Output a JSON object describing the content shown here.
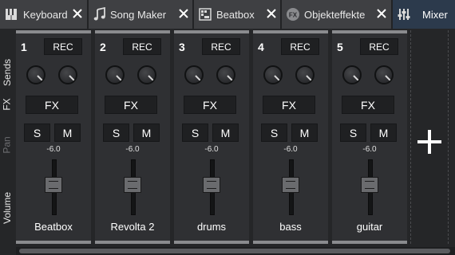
{
  "tabs": [
    {
      "label": "Keyboard",
      "icon": "piano-icon",
      "active": false
    },
    {
      "label": "Song Maker",
      "icon": "music-note-icon",
      "active": false
    },
    {
      "label": "Beatbox",
      "icon": "grid-icon",
      "active": false
    },
    {
      "label": "Objekteffekte",
      "icon": "fx-circle-icon",
      "active": false
    },
    {
      "label": "Mixer",
      "icon": "mixer-sliders-icon",
      "active": true
    }
  ],
  "side_labels": {
    "sends": "Sends",
    "fx": "FX",
    "pan": "Pan",
    "volume": "Volume"
  },
  "channels": [
    {
      "number": "1",
      "rec": "REC",
      "fx": "FX",
      "solo": "S",
      "mute": "M",
      "volume": "-6.0",
      "name": "Beatbox"
    },
    {
      "number": "2",
      "rec": "REC",
      "fx": "FX",
      "solo": "S",
      "mute": "M",
      "volume": "-6.0",
      "name": "Revolta 2"
    },
    {
      "number": "3",
      "rec": "REC",
      "fx": "FX",
      "solo": "S",
      "mute": "M",
      "volume": "-6.0",
      "name": "drums"
    },
    {
      "number": "4",
      "rec": "REC",
      "fx": "FX",
      "solo": "S",
      "mute": "M",
      "volume": "-6.0",
      "name": "bass"
    },
    {
      "number": "5",
      "rec": "REC",
      "fx": "FX",
      "solo": "S",
      "mute": "M",
      "volume": "-6.0",
      "name": "guitar"
    }
  ],
  "add_channel_icon": "plus-icon",
  "colors": {
    "background": "#252628",
    "strip": "#2f3033",
    "active_tab": "#2c3a4c",
    "button": "#1f2022"
  }
}
